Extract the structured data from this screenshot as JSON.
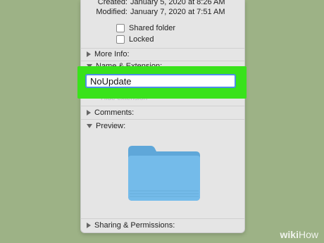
{
  "info": {
    "created_label": "Created:",
    "created_value": "January 5, 2020 at 8:26 AM",
    "modified_label": "Modified:",
    "modified_value": "January 7, 2020 at 7:51 AM"
  },
  "checkboxes": [
    {
      "label": "Shared folder",
      "checked": false
    },
    {
      "label": "Locked",
      "checked": false
    }
  ],
  "sections": {
    "more_info": "More Info:",
    "name_extension": "Name & Extension:",
    "hide_extension": "Hide extension",
    "comments": "Comments:",
    "preview": "Preview:",
    "sharing": "Sharing & Permissions:"
  },
  "name_field": {
    "value": "NoUpdate"
  },
  "colors": {
    "highlight": "#39e21b",
    "panel": "#e5e5e5",
    "background": "#9db286",
    "focus_ring": "#4e8de8",
    "folder": "#6cb4e4"
  },
  "preview_icon": "folder-icon",
  "watermark": {
    "wiki": "wiki",
    "how": "How"
  }
}
